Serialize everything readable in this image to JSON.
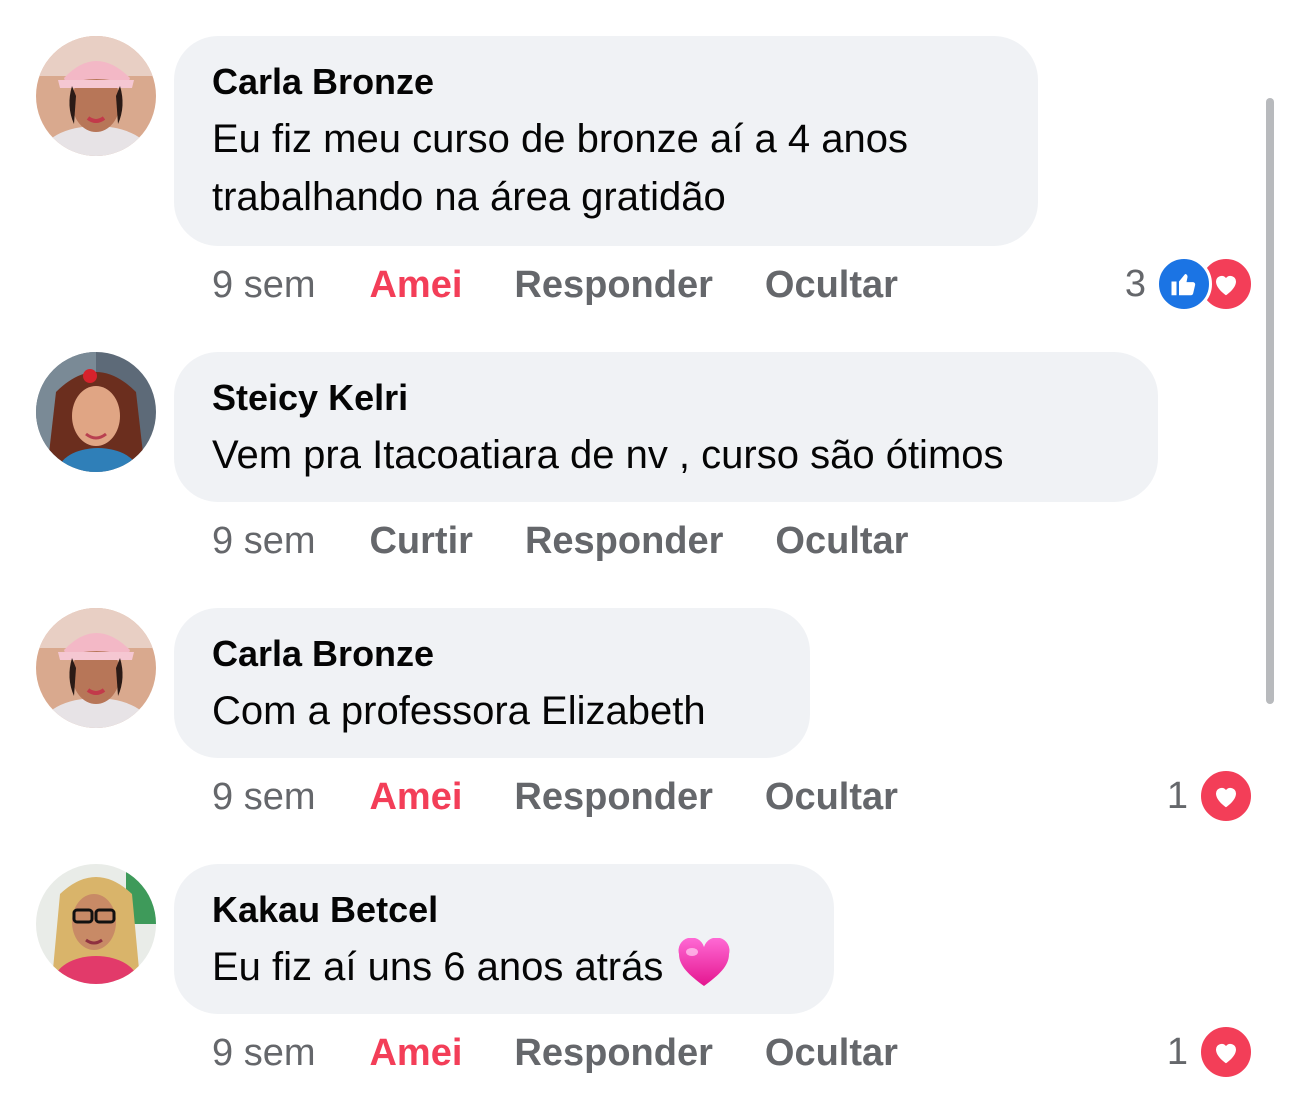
{
  "comments": [
    {
      "author": "Carla Bronze",
      "lines": [
        "Eu fiz meu curso de bronze aí a 4 anos",
        "trabalhando na área gratidão"
      ],
      "time": "9 sem",
      "like_label": "Amei",
      "like_active": true,
      "reply_label": "Responder",
      "hide_label": "Ocultar",
      "reaction_count": "3",
      "reactions": [
        "like-icon",
        "love-icon"
      ]
    },
    {
      "author": "Steicy Kelri",
      "lines": [
        "Vem pra Itacoatiara de nv , curso são ótimos"
      ],
      "time": "9 sem",
      "like_label": "Curtir",
      "like_active": false,
      "reply_label": "Responder",
      "hide_label": "Ocultar",
      "reaction_count": "",
      "reactions": []
    },
    {
      "author": "Carla Bronze",
      "lines": [
        "Com a professora Elizabeth"
      ],
      "time": "9 sem",
      "like_label": "Amei",
      "like_active": true,
      "reply_label": "Responder",
      "hide_label": "Ocultar",
      "reaction_count": "1",
      "reactions": [
        "love-icon"
      ]
    },
    {
      "author": "Kakau Betcel",
      "lines": [
        "Eu fiz aí uns 6 anos atrás"
      ],
      "emoji": "pink-heart-emoji",
      "time": "9 sem",
      "like_label": "Amei",
      "like_active": true,
      "reply_label": "Responder",
      "hide_label": "Ocultar",
      "reaction_count": "1",
      "reactions": [
        "love-icon"
      ]
    }
  ],
  "colors": {
    "bubble": "#f0f2f5",
    "meta_text": "#65676b",
    "love": "#f33e58",
    "like": "#1b74e4"
  }
}
